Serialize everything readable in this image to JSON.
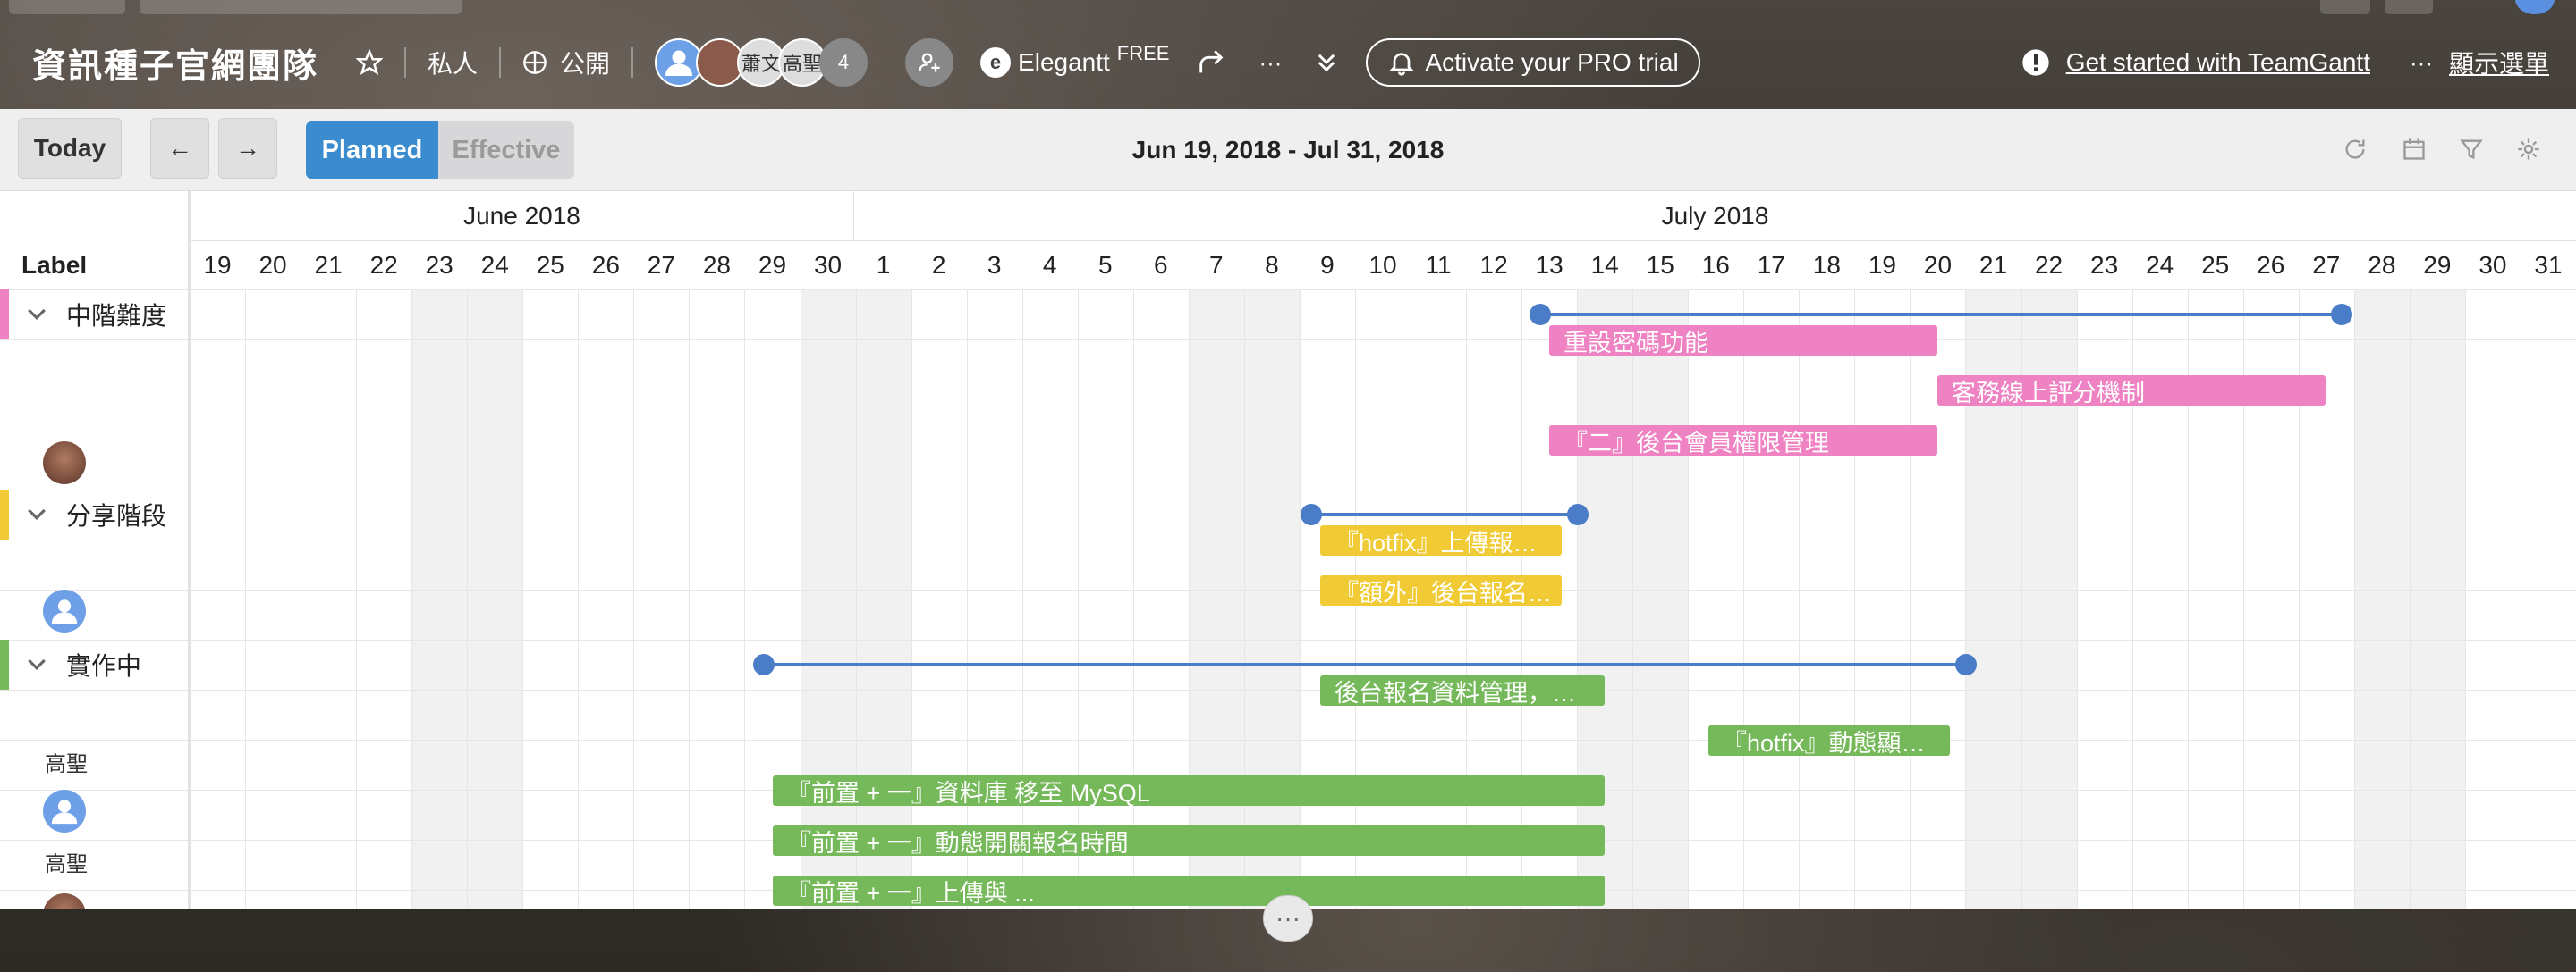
{
  "colors": {
    "accent": "#3b8ccf",
    "summary": "#4a7cc7",
    "pink": "#ee82c2",
    "yellow": "#f0cb35",
    "green": "#75b95a"
  },
  "header": {
    "project_title": "資訊種子官網團隊",
    "privacy_private": "私人",
    "privacy_public": "公開",
    "avatar_names": [
      "蕭文",
      "高聖"
    ],
    "member_count": "4",
    "app_name": "Elegantt",
    "plan_badge": "FREE",
    "more_label": "···",
    "pro_trial_label": "Activate your PRO trial",
    "get_started_label": "Get started with TeamGantt",
    "show_menu_label": "顯示選單"
  },
  "toolbar": {
    "today_label": "Today",
    "prev_label": "←",
    "next_label": "→",
    "planned_label": "Planned",
    "effective_label": "Effective",
    "date_range": "Jun 19, 2018 - Jul 31, 2018"
  },
  "timeline": {
    "label_header": "Label",
    "months": [
      "June 2018",
      "July 2018"
    ],
    "days": [
      "19",
      "20",
      "21",
      "22",
      "23",
      "24",
      "25",
      "26",
      "27",
      "28",
      "29",
      "30",
      "1",
      "2",
      "3",
      "4",
      "5",
      "6",
      "7",
      "8",
      "9",
      "10",
      "11",
      "12",
      "13",
      "14",
      "15",
      "16",
      "17",
      "18",
      "19",
      "20",
      "21",
      "22",
      "23",
      "24",
      "25",
      "26",
      "27",
      "28",
      "29",
      "30",
      "31"
    ]
  },
  "groups": [
    {
      "label": "中階難度",
      "color": "#ee82c2"
    },
    {
      "label": "分享階段",
      "color": "#f0cb35"
    },
    {
      "label": "實作中",
      "color": "#75b95a"
    }
  ],
  "row_text_avatars": [
    "高聖",
    "高聖"
  ],
  "tasks": [
    {
      "text": "重設密碼功能"
    },
    {
      "text": "客務線上評分機制"
    },
    {
      "text": "『二』後台會員權限管理"
    },
    {
      "text": "『hotfix』上傳報…"
    },
    {
      "text": "『額外』後台報名…"
    },
    {
      "text": "後台報名資料管理，…"
    },
    {
      "text": "『hotfix』動態顯…"
    },
    {
      "text": "『前置 + 一』資料庫 移至 MySQL"
    },
    {
      "text": "『前置 + 一』動態開關報名時間"
    },
    {
      "text": "『前置 + 一』上傳與 ..."
    }
  ]
}
